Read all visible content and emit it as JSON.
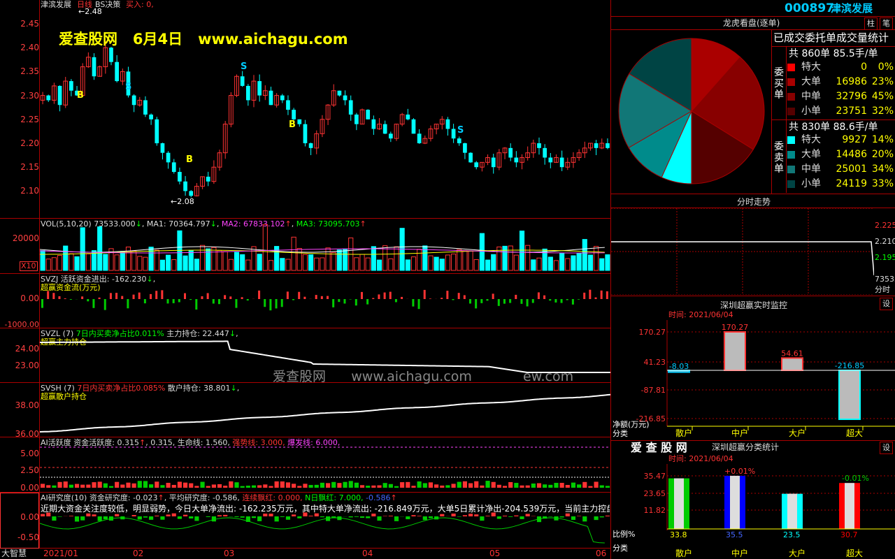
{
  "colors": {
    "red": "#ff3333",
    "cyan": "#00ffff",
    "green": "#00cc00",
    "yellow": "#ffff00",
    "magenta": "#ff44ff",
    "grid": "#aa0000"
  },
  "chart": {
    "stock_name": "津滨发展",
    "period": "日线",
    "strategy": "BS决策",
    "buy_label": "买入: 0,",
    "watermark_top": "爱查股网   6月4日   www.aichagu.com",
    "watermark_mid": "爱查股网      www.aichagu.com",
    "watermark_mid_tail": "ew.com",
    "high_mark": "←2.48",
    "low_mark": "←2.08",
    "price_ticks": [
      "2.45",
      "2.40",
      "2.35",
      "2.30",
      "2.25",
      "2.20",
      "2.15",
      "2.10"
    ]
  },
  "vol": {
    "title": "VOL(5,10,20)",
    "val": "73533.000",
    "ma1": "MA1: 70364.797",
    "ma2": "MA2: 67833.102",
    "ma3": "MA3: 73095.703",
    "tick": "20000",
    "unit": "X10"
  },
  "svzj": {
    "title": "SVZJ",
    "label": "活跃资金进出:",
    "val": "-162.230",
    "sub": "超赢资金流(万元)",
    "tick0": "0.00",
    "tick1": "-1000.00"
  },
  "svzl": {
    "title": "SVZL (7)",
    "ratio": "7日内买卖净占比0.011%",
    "label": "主力持仓:",
    "val": "22.447",
    "sub": "超赢主力持仓",
    "ticks": [
      "24.00",
      "23.00"
    ]
  },
  "svsh": {
    "title": "SVSH (7)",
    "ratio": "7日内买卖净占比0.085%",
    "label": "散户持仓:",
    "val": "38.801",
    "sub": "超赢散户持仓",
    "ticks": [
      "38.00",
      "36.00"
    ]
  },
  "ai_active": {
    "title": "AI活跃度",
    "label": "资金活跃度:",
    "val": "0.315",
    "val2": "0.315,",
    "life": "生命线: 1.560,",
    "strong": "强势线: 3.000,",
    "burst": "爆发线: 6.000,",
    "ticks": [
      "5.00",
      "2.50",
      "0.00"
    ]
  },
  "ai_research": {
    "title": "AI研究度(10)",
    "label": "资金研究度:",
    "val": "-0.023",
    "avg": "平均研究度: -0.586,",
    "red_days": "连续飘红: 0.000,",
    "n_red": "N日飘红: 7.000,",
    "tail": "-0.586",
    "comment": "近期大资金关注度较低，明显弱势，今日大单净流出: -162.235万元，其中特大单净流出: -216.849万元，大单5日累计净出-204.539万元，当前主力控盘弱",
    "ticks": [
      "0.00",
      "-0.50"
    ]
  },
  "dates": [
    "2021/01",
    "02",
    "03",
    "04",
    "05",
    "06"
  ],
  "brand": "大智慧",
  "header": {
    "code": "000897",
    "name": "津滨发展",
    "btn1": "柱",
    "btn2": "笔"
  },
  "dragon": {
    "title": "龙虎看盘(逐单)",
    "stat_title": "已成交委托单成交量统计",
    "buy_vertical": "委买单",
    "sell_vertical": "委卖单",
    "buy_total": "共 860单 85.5手/单",
    "sell_total": "共 830单 88.6手/单",
    "buy_rows": [
      {
        "label": "特大",
        "qty": "0",
        "pct": "0%",
        "color": "#ff0000"
      },
      {
        "label": "大单",
        "qty": "16986",
        "pct": "23%",
        "color": "#aa0000"
      },
      {
        "label": "中单",
        "qty": "32796",
        "pct": "45%",
        "color": "#880000"
      },
      {
        "label": "小单",
        "qty": "23751",
        "pct": "32%",
        "color": "#550000"
      }
    ],
    "sell_rows": [
      {
        "label": "特大",
        "qty": "9927",
        "pct": "14%",
        "color": "#00ffff"
      },
      {
        "label": "大单",
        "qty": "14486",
        "pct": "20%",
        "color": "#008b8b"
      },
      {
        "label": "中单",
        "qty": "25001",
        "pct": "34%",
        "color": "#117777"
      },
      {
        "label": "小单",
        "qty": "24119",
        "pct": "33%",
        "color": "#004444"
      }
    ]
  },
  "intraday": {
    "title": "分时走势",
    "ticks": [
      "2.225",
      "2.210",
      "2.195"
    ],
    "vol": "73533",
    "label": "分时"
  },
  "monitor": {
    "title": "深圳超赢实时监控",
    "gear": "设",
    "time": "时间: 2021/06/04",
    "yticks": [
      "170.27",
      "41.23",
      "-87.81",
      "-216.85"
    ],
    "ylabel": "净额(万元)",
    "xlabel": "分类",
    "cats": [
      "散户",
      "中户",
      "大户",
      "超大"
    ],
    "values": [
      "-8.03",
      "170.27",
      "54.61",
      "-216.85"
    ]
  },
  "classify": {
    "logo": "爱 查 股 网",
    "title": "深圳超赢分类统计",
    "gear": "设",
    "time": "时间: 2021/06/04",
    "yticks": [
      "35.47",
      "23.65",
      "11.82"
    ],
    "ylabel": "比例%",
    "xlabel": "分类",
    "cats": [
      "散户",
      "中户",
      "大户",
      "超大"
    ],
    "values": [
      "33.8",
      "35.5",
      "23.5",
      "30.7"
    ],
    "diff_zhong": "+0.01%",
    "diff_chao": "-0.01%"
  },
  "chart_data": [
    {
      "type": "bar",
      "title": "深圳超赢实时监控",
      "categories": [
        "散户",
        "中户",
        "大户",
        "超大"
      ],
      "values": [
        -8.03,
        170.27,
        54.61,
        -216.85
      ],
      "ylabel": "净额(万元)",
      "xlabel": "分类"
    },
    {
      "type": "bar",
      "title": "深圳超赢分类统计",
      "categories": [
        "散户",
        "中户",
        "大户",
        "超大"
      ],
      "values": [
        33.8,
        35.5,
        23.5,
        30.7
      ],
      "ylabel": "比例%",
      "xlabel": "分类"
    },
    {
      "type": "pie",
      "title": "龙虎看盘(逐单)",
      "categories": [
        "买特大",
        "买大单",
        "买中单",
        "买小单",
        "卖特大",
        "卖大单",
        "卖中单",
        "卖小单"
      ],
      "values": [
        0,
        16986,
        32796,
        23751,
        9927,
        14486,
        25001,
        24119
      ]
    }
  ]
}
